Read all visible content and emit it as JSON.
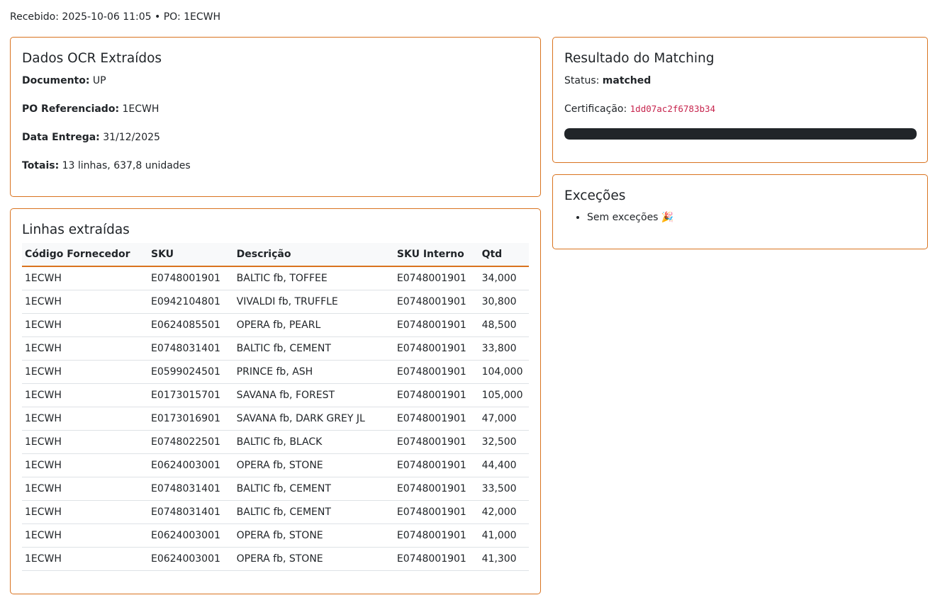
{
  "header": {
    "text": "Recebido: 2025-10-06 11:05 • PO: 1ECWH"
  },
  "ocr": {
    "title": "Dados OCR Extraídos",
    "documento_label": "Documento:",
    "documento_value": "UP",
    "po_label": "PO Referenciado:",
    "po_value": "1ECWH",
    "entrega_label": "Data Entrega:",
    "entrega_value": "31/12/2025",
    "totais_label": "Totais:",
    "totais_value": "13 linhas, 637,8 unidades"
  },
  "matching": {
    "title": "Resultado do Matching",
    "status_label": "Status:",
    "status_value": "matched",
    "cert_label": "Certificação:",
    "cert_value": "1dd07ac2f6783b34",
    "progress_fraction": 1.0,
    "progress_color": "#212529"
  },
  "exceptions": {
    "title": "Exceções",
    "items": [
      "Sem exceções 🎉"
    ]
  },
  "lines": {
    "title": "Linhas extraídas",
    "columns": [
      "Código Fornecedor",
      "SKU",
      "Descrição",
      "SKU Interno",
      "Qtd"
    ],
    "rows": [
      [
        "1ECWH",
        "E0748001901",
        "BALTIC fb, TOFFEE",
        "E0748001901",
        "34,000"
      ],
      [
        "1ECWH",
        "E0942104801",
        "VIVALDI fb, TRUFFLE",
        "E0748001901",
        "30,800"
      ],
      [
        "1ECWH",
        "E0624085501",
        "OPERA fb, PEARL",
        "E0748001901",
        "48,500"
      ],
      [
        "1ECWH",
        "E0748031401",
        "BALTIC fb, CEMENT",
        "E0748001901",
        "33,800"
      ],
      [
        "1ECWH",
        "E0599024501",
        "PRINCE fb, ASH",
        "E0748001901",
        "104,000"
      ],
      [
        "1ECWH",
        "E0173015701",
        "SAVANA fb, FOREST",
        "E0748001901",
        "105,000"
      ],
      [
        "1ECWH",
        "E0173016901",
        "SAVANA fb, DARK GREY JL",
        "E0748001901",
        "47,000"
      ],
      [
        "1ECWH",
        "E0748022501",
        "BALTIC fb, BLACK",
        "E0748001901",
        "32,500"
      ],
      [
        "1ECWH",
        "E0624003001",
        "OPERA fb, STONE",
        "E0748001901",
        "44,400"
      ],
      [
        "1ECWH",
        "E0748031401",
        "BALTIC fb, CEMENT",
        "E0748001901",
        "33,500"
      ],
      [
        "1ECWH",
        "E0748031401",
        "BALTIC fb, CEMENT",
        "E0748001901",
        "42,000"
      ],
      [
        "1ECWH",
        "E0624003001",
        "OPERA fb, STONE",
        "E0748001901",
        "41,000"
      ],
      [
        "1ECWH",
        "E0624003001",
        "OPERA fb, STONE",
        "E0748001901",
        "41,300"
      ]
    ]
  },
  "colors": {
    "card_border": "#d9731f",
    "code_text": "#c7254e"
  }
}
